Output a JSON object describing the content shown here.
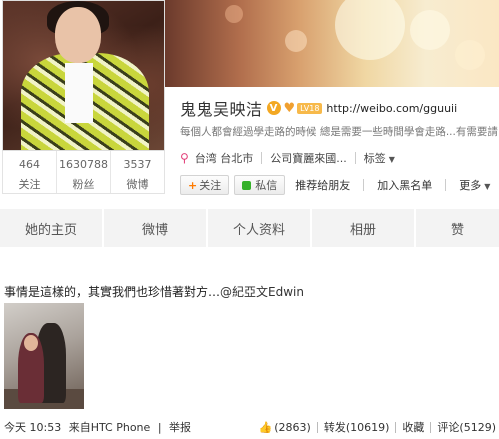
{
  "profile": {
    "name": "鬼鬼吴映洁",
    "verified_badge": "V",
    "level_badge": "LV18",
    "url": "http://weibo.com/gguuii",
    "bio": "每個人都會經過學走路的時候 總是需要一些時間學會走路...有需要請",
    "location": "台湾 台北市",
    "company": "公司寶麗來國...",
    "tags_label": "标签",
    "stats": [
      {
        "value": "464",
        "label": "关注"
      },
      {
        "value": "1630788",
        "label": "粉丝"
      },
      {
        "value": "3537",
        "label": "微博"
      }
    ]
  },
  "actions": {
    "follow_label": "关注",
    "message_label": "私信",
    "recommend_label": "推荐给朋友",
    "blacklist_label": "加入黑名单",
    "more_label": "更多"
  },
  "tabs": [
    {
      "label": "她的主页"
    },
    {
      "label": "微博"
    },
    {
      "label": "个人资料"
    },
    {
      "label": "相册"
    },
    {
      "label": "赞"
    }
  ],
  "post": {
    "text": "事情是這樣的，其實我們也珍惜著對方…",
    "mention": "@紀亞文Edwin",
    "time": "今天 10:53",
    "source": "来自HTC Phone",
    "report": "举报",
    "likes": "(2863)",
    "repost": "转发(10619)",
    "favorite": "收藏",
    "comment": "评论(5129)"
  },
  "colors": {
    "accent_orange": "#ff7b00",
    "message_green": "#35b12a",
    "tab_bg": "#f3f3f3"
  }
}
